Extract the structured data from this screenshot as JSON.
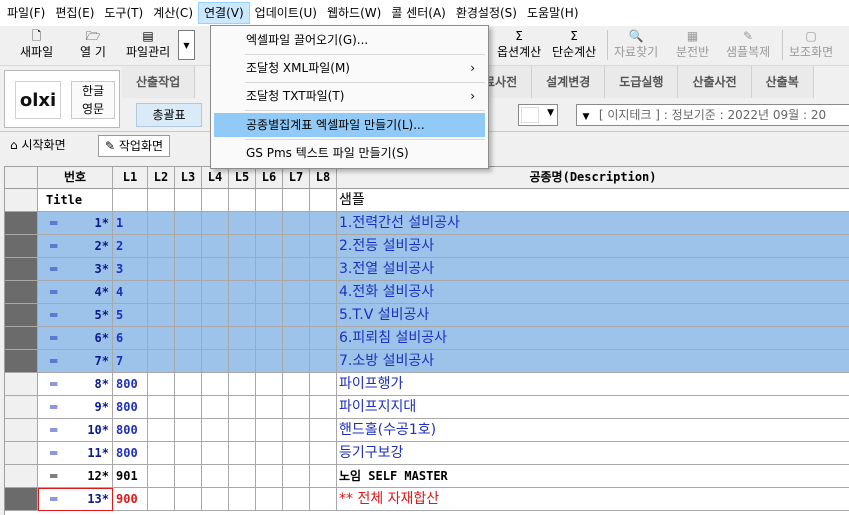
{
  "menubar": [
    "파일(F)",
    "편집(E)",
    "도구(T)",
    "계산(C)",
    "연결(V)",
    "업데이트(U)",
    "웹하드(W)",
    "콜 센터(A)",
    "환경설정(S)",
    "도움말(H)"
  ],
  "toolbar": {
    "new_file": "새파일",
    "open": "열 기",
    "file_manager": "파일관리",
    "route_calc": "옵션계산",
    "simple_calc": "단순계산",
    "material_search": "자료찾기",
    "split_panel": "분전반",
    "sample_copy": "샘플복제",
    "aux_screen": "보조화면"
  },
  "panel": {
    "logo_text": "olxi",
    "lang_ko": "한글",
    "lang_en": "영문",
    "tabs_left": [
      "산출작업"
    ],
    "tabs_right": [
      "료사전",
      "설계변경",
      "도급실행",
      "산출사전",
      "산출복"
    ],
    "summary_button": "총괄표",
    "info_text": "[ 이지테크 ] : 정보기준 : 2022년 09월 : 20"
  },
  "nav": {
    "start_screen": "시작화면",
    "work_screen": "작업화면"
  },
  "connect_menu": {
    "items": [
      {
        "label": "엑셀파일 끌어오기(G)...",
        "submenu": false
      },
      {
        "label": "조달청 XML파일(M)",
        "submenu": true
      },
      {
        "label": "조달청 TXT파일(T)",
        "submenu": true
      },
      {
        "label": "공종별집계표 엑셀파일 만들기(L)...",
        "submenu": false
      },
      {
        "label": "GS Pms 텍스트 파일 만들기(S)",
        "submenu": false
      }
    ]
  },
  "grid": {
    "headers": [
      "번호",
      "L1",
      "L2",
      "L3",
      "L4",
      "L5",
      "L6",
      "L7",
      "L8",
      "공종명(Description)"
    ],
    "title_row": {
      "num": "Title",
      "desc": "샘플"
    },
    "rows": [
      {
        "num": "1*",
        "l1": "1",
        "desc": "1.전력간선 설비공사"
      },
      {
        "num": "2*",
        "l1": "2",
        "desc": "2.전등 설비공사"
      },
      {
        "num": "3*",
        "l1": "3",
        "desc": "3.전열 설비공사"
      },
      {
        "num": "4*",
        "l1": "4",
        "desc": "4.전화 설비공사"
      },
      {
        "num": "5*",
        "l1": "5",
        "desc": "5.T.V 설비공사"
      },
      {
        "num": "6*",
        "l1": "6",
        "desc": "6.피뢰침 설비공사"
      },
      {
        "num": "7*",
        "l1": "7",
        "desc": "7.소방 설비공사"
      },
      {
        "num": "8*",
        "l1": "800",
        "desc": "파이프행가"
      },
      {
        "num": "9*",
        "l1": "800",
        "desc": "파이프지지대"
      },
      {
        "num": "10*",
        "l1": "800",
        "desc": "핸드홀(수공1호)"
      },
      {
        "num": "11*",
        "l1": "800",
        "desc": "등기구보강"
      },
      {
        "num": "12*",
        "l1": "901",
        "desc": "노임 SELF MASTER"
      },
      {
        "num": "13*",
        "l1": "900",
        "desc": "** 전체 자재합산"
      }
    ],
    "eq_glyph": "═"
  },
  "colors": {
    "row_highlight": "#9dc3ea",
    "text_blue": "#1d2fbf",
    "text_red": "#e01818",
    "menu_hover": "#91c9f7"
  }
}
